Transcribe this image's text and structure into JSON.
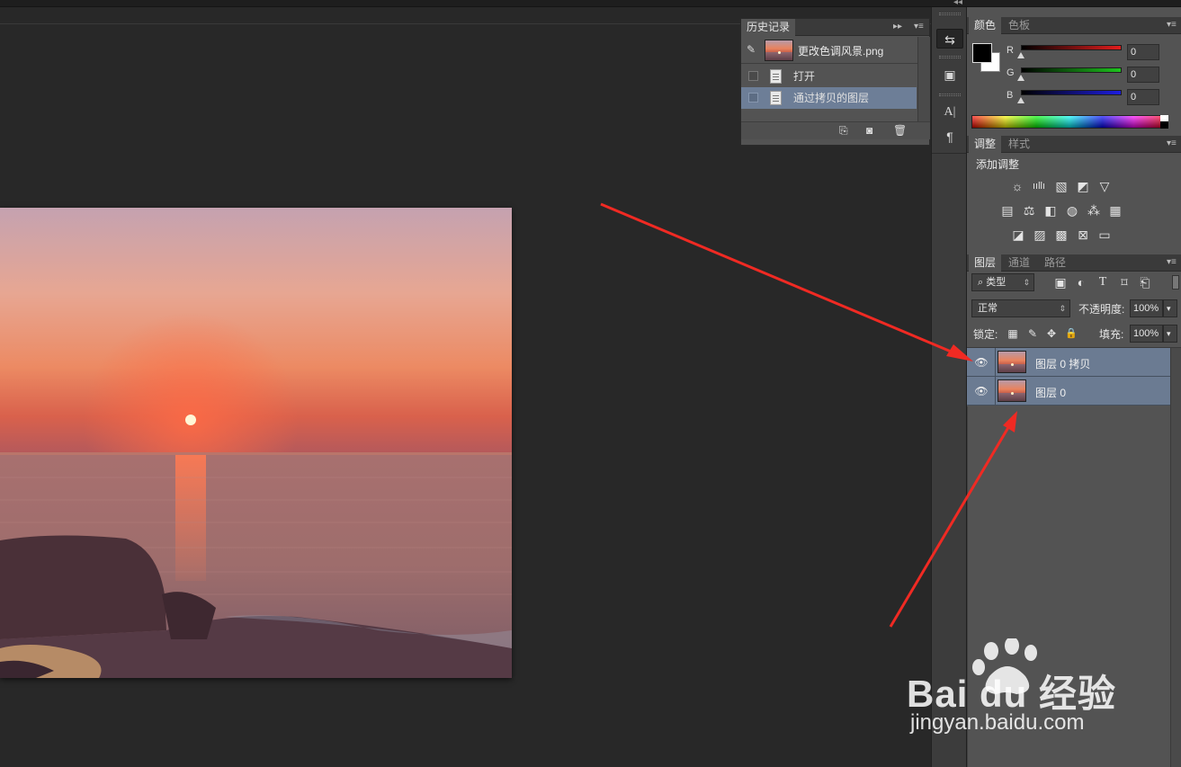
{
  "history_panel": {
    "tab_label": "历史记录",
    "snapshot_name": "更改色调风景.png",
    "items": [
      {
        "label": "打开",
        "selected": false
      },
      {
        "label": "通过拷贝的图层",
        "selected": true
      }
    ]
  },
  "color_panel": {
    "tabs": [
      "颜色",
      "色板"
    ],
    "channels": [
      {
        "label": "R",
        "value": "0",
        "color": "#e31d1d"
      },
      {
        "label": "G",
        "value": "0",
        "color": "#1ec41e"
      },
      {
        "label": "B",
        "value": "0",
        "color": "#1d1de0"
      }
    ]
  },
  "adjustments_panel": {
    "tabs": [
      "调整",
      "样式"
    ],
    "heading": "添加调整"
  },
  "layers_panel": {
    "tabs": [
      "图层",
      "通道",
      "路径"
    ],
    "filter_label": "类型",
    "blend_mode": "正常",
    "opacity_label": "不透明度:",
    "opacity_value": "100%",
    "lock_label": "锁定:",
    "fill_label": "填充:",
    "fill_value": "100%",
    "layers": [
      {
        "name": "图层 0 拷贝"
      },
      {
        "name": "图层 0"
      }
    ]
  },
  "dock": {
    "type_icon": "A|",
    "paragraph_icon": "¶"
  },
  "colors": {
    "layer_selected": "#6b7b92",
    "annotation_arrow": "#f02a23"
  },
  "watermark": {
    "brand": "Bai du 经验",
    "url": "jingyan.baidu.com"
  }
}
